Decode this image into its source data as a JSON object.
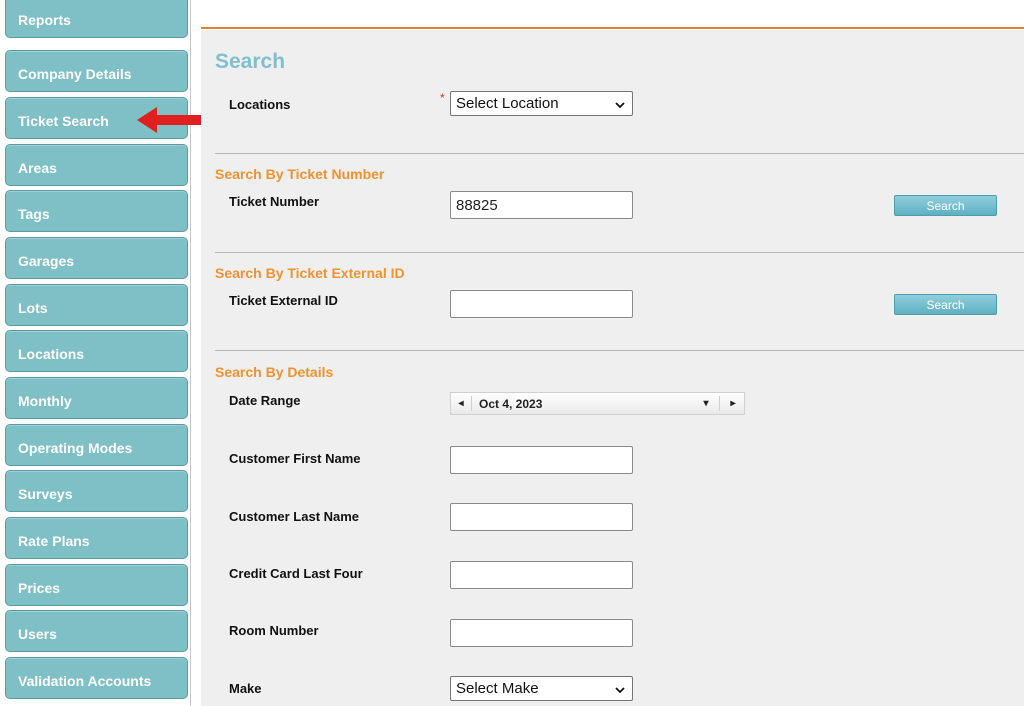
{
  "sidebar": {
    "items": [
      {
        "label": "Reports"
      },
      {
        "label": "Company Details"
      },
      {
        "label": "Ticket Search"
      },
      {
        "label": "Areas"
      },
      {
        "label": "Tags"
      },
      {
        "label": "Garages"
      },
      {
        "label": "Lots"
      },
      {
        "label": "Locations"
      },
      {
        "label": "Monthly"
      },
      {
        "label": "Operating Modes"
      },
      {
        "label": "Surveys"
      },
      {
        "label": "Rate Plans"
      },
      {
        "label": "Prices"
      },
      {
        "label": "Users"
      },
      {
        "label": "Validation Accounts"
      }
    ]
  },
  "colors": {
    "accent": "#f0922f",
    "sidebar": "#7fbfc6",
    "title": "#7fbfd0",
    "arrow": "#e02020"
  },
  "page": {
    "title": "Search"
  },
  "locations": {
    "label": "Locations",
    "required_mark": "*",
    "value": "Select Location"
  },
  "by_ticket_number": {
    "section": "Search By Ticket Number",
    "label": "Ticket Number",
    "value": "88825",
    "button": "Search"
  },
  "by_external_id": {
    "section": "Search By Ticket External ID",
    "label": "Ticket External ID",
    "value": "",
    "button": "Search"
  },
  "by_details": {
    "section": "Search By Details",
    "date_range": {
      "label": "Date Range",
      "value": "Oct 4, 2023",
      "prev": "◂",
      "dropdown": "▾",
      "next": "▸"
    },
    "first_name": {
      "label": "Customer First Name",
      "value": ""
    },
    "last_name": {
      "label": "Customer Last Name",
      "value": ""
    },
    "card_last_four": {
      "label": "Credit Card Last Four",
      "value": ""
    },
    "room_number": {
      "label": "Room Number",
      "value": ""
    },
    "make": {
      "label": "Make",
      "value": "Select Make"
    }
  },
  "icons": {
    "chevron": "chevron-down-icon",
    "pointer": "red-arrow-icon"
  }
}
